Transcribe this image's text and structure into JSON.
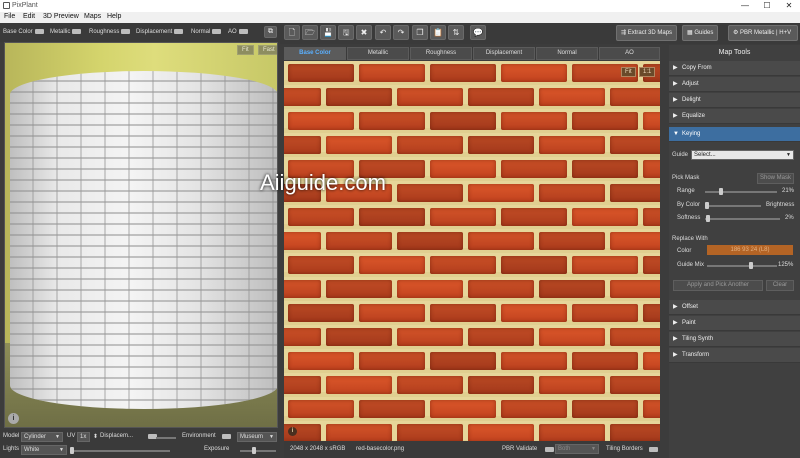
{
  "window": {
    "title": "PixPlant",
    "buttons": [
      "—",
      "☐",
      "✕"
    ]
  },
  "menu": [
    "File",
    "Edit",
    "3D Preview",
    "Maps",
    "Help"
  ],
  "preview_toggles": [
    "Base Color",
    "Metallic",
    "Roughness",
    "Displacement",
    "Normal",
    "AO"
  ],
  "viewport": {
    "fit": "Fit",
    "fast": "Fast",
    "info": "i"
  },
  "toolbar": {
    "extract": "Extract 3D Maps",
    "guides": "Guides",
    "workflow": "PBR Metallic | H+V"
  },
  "tabs": [
    "Base Color",
    "Metallic",
    "Roughness",
    "Displacement",
    "Normal",
    "AO"
  ],
  "active_tab": 0,
  "texture_buttons": {
    "fit": "Fit",
    "one": "1:1"
  },
  "status": {
    "resolution": "2048 x 2048 x sRGB",
    "filename": "red-basecolor.png",
    "pbr": "PBR Validate",
    "pbr_mode": "Both",
    "tiling": "Tiling Borders"
  },
  "bottom": {
    "model_label": "Model",
    "model": "Cylinder",
    "uv_label": "UV",
    "uv": "1x",
    "displacement": "Displacem...",
    "environment_label": "Environment",
    "environment": "Museum",
    "lights_label": "Lights",
    "lights": "White",
    "exposure": "Exposure"
  },
  "panel": {
    "title": "Map Tools",
    "sections_top": [
      "Copy From",
      "Adjust",
      "Delight",
      "Equalize"
    ],
    "open_section": "Keying",
    "guide_label": "Guide",
    "guide_value": "Select...",
    "pick_mask": "Pick Mask",
    "show_mask": "Show Mask",
    "range_label": "Range",
    "range_value": "21%",
    "by_color": "By Color",
    "brightness": "Brightness",
    "softness_label": "Softness",
    "softness_value": "2%",
    "replace_with": "Replace With",
    "color_label": "Color",
    "color_value": "186 93 24 (L8)",
    "guide_mix_label": "Guide Mix",
    "guide_mix_value": "125%",
    "apply": "Apply and Pick Another",
    "clear": "Clear",
    "sections_bottom": [
      "Offset",
      "Paint",
      "Tiling Synth",
      "Transform"
    ]
  },
  "watermark": "Aiiguide.com",
  "colors": {
    "accent": "#3d6ea0",
    "tab_active": "#5ab0ff",
    "key_color": "#b46425"
  }
}
